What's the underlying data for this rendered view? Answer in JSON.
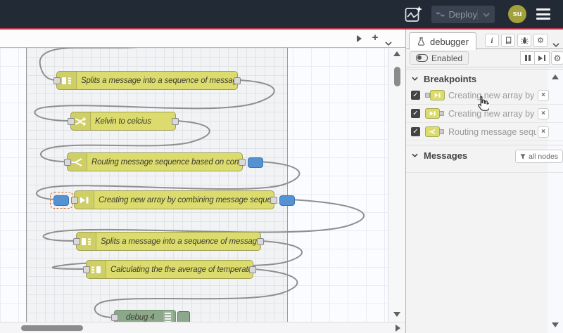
{
  "header": {
    "deploy_label": "Deploy",
    "avatar_initials": "su"
  },
  "workspace": {
    "nodes": [
      {
        "label": "Splits a message into a sequence of messages.",
        "type": "split"
      },
      {
        "label": "Kelvin to celcius",
        "type": "change"
      },
      {
        "label": "Routing message sequence based on condition",
        "type": "switch",
        "breakpoint_output": true
      },
      {
        "label": "Creating new array by combining message sequence",
        "type": "join",
        "breakpoint_input": true,
        "breakpoint_output": true,
        "breakpoint_input_selected": true
      },
      {
        "label": "Splits a message into a sequence of messages.",
        "type": "split"
      },
      {
        "label": "Calculating the the average of temperature",
        "type": "join"
      },
      {
        "label": "debug 4",
        "type": "debug"
      }
    ]
  },
  "sidebar": {
    "tab_label": "debugger",
    "toolbar_icons": [
      "info",
      "book",
      "bug",
      "gear"
    ],
    "enabled_label": "Enabled",
    "breakpoints": {
      "title": "Breakpoints",
      "items": [
        {
          "label": "Creating new array by combining message sequence",
          "checked": true,
          "port": "input",
          "node_type": "join"
        },
        {
          "label": "Creating new array by combining message sequence",
          "checked": true,
          "port": "output",
          "node_type": "join"
        },
        {
          "label": "Routing message sequence based on condition",
          "checked": true,
          "port": "output",
          "node_type": "switch"
        }
      ]
    },
    "messages": {
      "title": "Messages",
      "filter_label": "all nodes"
    }
  },
  "colors": {
    "accent_red": "#b73349",
    "header_bg": "#222a36",
    "node_yellow": "#dcdc6e",
    "node_green": "#8ca88b",
    "breakpoint_blue": "#5592d2"
  }
}
